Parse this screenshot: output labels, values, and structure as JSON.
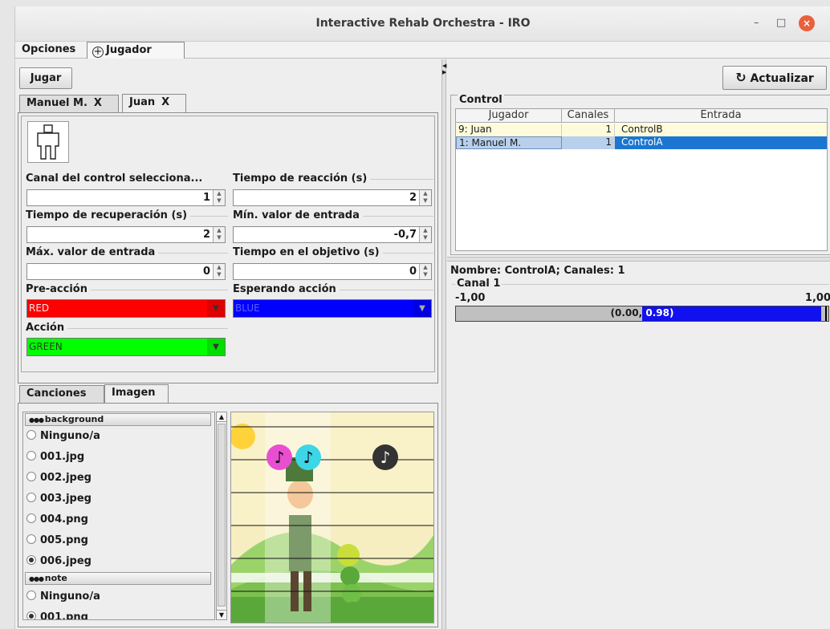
{
  "window": {
    "title": "Interactive Rehab Orchestra - IRO",
    "minimize": "–",
    "maximize": "□",
    "close": "×"
  },
  "menu": {
    "opciones": "Opciones",
    "jugador": "Jugador",
    "jugador_icon": "+"
  },
  "left": {
    "jugar_button": "Jugar",
    "player_tabs": [
      {
        "label": "Manuel M.",
        "close": "X"
      },
      {
        "label": "Juan",
        "close": "X"
      }
    ],
    "avatar_icon": "person-silhouette-icon",
    "fields": {
      "canal": {
        "label": "Canal del control selecciona...",
        "value": "1"
      },
      "reaccion": {
        "label": "Tiempo de reacción (s)",
        "value": "2"
      },
      "recuperacion": {
        "label": "Tiempo de recuperación (s)",
        "value": "2"
      },
      "min_entrada": {
        "label": "Mín. valor de entrada",
        "value": "-0,7"
      },
      "max_entrada": {
        "label": "Máx. valor de entrada",
        "value": "0"
      },
      "objetivo": {
        "label": "Tiempo en el objetivo (s)",
        "value": "0"
      }
    },
    "combos": {
      "pre_accion": {
        "label": "Pre-acción",
        "value": "RED",
        "color": "#ff0000"
      },
      "esperando": {
        "label": "Esperando acción",
        "value": "BLUE",
        "color": "#0000ff"
      },
      "accion": {
        "label": "Acción",
        "value": "GREEN",
        "color": "#00ff00"
      }
    },
    "bottom_tabs": [
      {
        "label": "Canciones"
      },
      {
        "label": "Imagen"
      }
    ],
    "image_list": {
      "background_header": "background",
      "background_items": [
        {
          "label": "Ninguno/a",
          "selected": false
        },
        {
          "label": "001.jpg",
          "selected": false
        },
        {
          "label": "002.jpeg",
          "selected": false
        },
        {
          "label": "003.jpeg",
          "selected": false
        },
        {
          "label": "004.png",
          "selected": false
        },
        {
          "label": "005.png",
          "selected": false
        },
        {
          "label": "006.jpeg",
          "selected": true
        }
      ],
      "note_header": "note",
      "note_items": [
        {
          "label": "Ninguno/a",
          "selected": false
        },
        {
          "label": "001.png",
          "selected": true
        }
      ]
    },
    "preview": {
      "notes": [
        {
          "color": "#e84fd0",
          "glyph": "♪"
        },
        {
          "color": "#3cd6e6",
          "glyph": "♪"
        },
        {
          "color": "#333333",
          "glyph": "♪"
        }
      ]
    }
  },
  "right": {
    "actualizar_button": "Actualizar",
    "control_title": "Control",
    "table": {
      "headers": [
        "Jugador",
        "Canales",
        "Entrada"
      ],
      "rows": [
        {
          "jugador": "9: Juan",
          "canales": "1",
          "entrada": "ControlB"
        },
        {
          "jugador": "1: Manuel M.",
          "canales": "1",
          "entrada": "ControlA"
        }
      ]
    },
    "info": {
      "nombre": "Nombre: ControlA; Canales: 1",
      "canal": "Canal 1",
      "min": "-1,00",
      "max": "1,00",
      "bar_text_a": "(0.00,",
      "bar_text_b": "0.98)",
      "bar_fill_fraction": 0.49
    }
  },
  "colors": {
    "selection": "#1a76d2",
    "row_highlight": "#fdfbdc"
  }
}
